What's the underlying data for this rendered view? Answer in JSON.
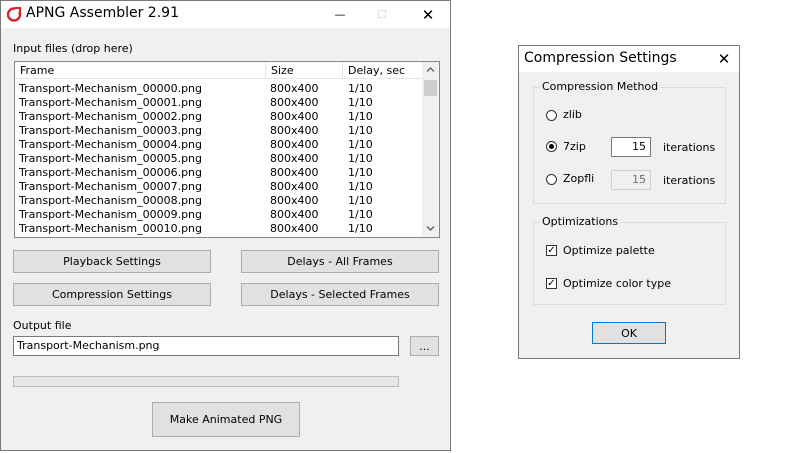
{
  "main_window": {
    "title": "APNG Assembler 2.91",
    "minimize_glyph": "—",
    "maximize_glyph": "☐",
    "close_glyph": "✕",
    "input_label": "Input files (drop here)",
    "columns": [
      "Frame",
      "Size",
      "Delay, sec"
    ],
    "rows": [
      {
        "frame": "Transport-Mechanism_00000.png",
        "size": "800x400",
        "delay": "1/10"
      },
      {
        "frame": "Transport-Mechanism_00001.png",
        "size": "800x400",
        "delay": "1/10"
      },
      {
        "frame": "Transport-Mechanism_00002.png",
        "size": "800x400",
        "delay": "1/10"
      },
      {
        "frame": "Transport-Mechanism_00003.png",
        "size": "800x400",
        "delay": "1/10"
      },
      {
        "frame": "Transport-Mechanism_00004.png",
        "size": "800x400",
        "delay": "1/10"
      },
      {
        "frame": "Transport-Mechanism_00005.png",
        "size": "800x400",
        "delay": "1/10"
      },
      {
        "frame": "Transport-Mechanism_00006.png",
        "size": "800x400",
        "delay": "1/10"
      },
      {
        "frame": "Transport-Mechanism_00007.png",
        "size": "800x400",
        "delay": "1/10"
      },
      {
        "frame": "Transport-Mechanism_00008.png",
        "size": "800x400",
        "delay": "1/10"
      },
      {
        "frame": "Transport-Mechanism_00009.png",
        "size": "800x400",
        "delay": "1/10"
      },
      {
        "frame": "Transport-Mechanism_00010.png",
        "size": "800x400",
        "delay": "1/10"
      }
    ],
    "buttons": {
      "playback": "Playback Settings",
      "delays_all": "Delays - All Frames",
      "compression": "Compression Settings",
      "delays_selected": "Delays - Selected Frames",
      "browse": "...",
      "make": "Make Animated PNG"
    },
    "output_label": "Output file",
    "output_value": "Transport-Mechanism.png",
    "progress": 0
  },
  "dialog": {
    "title": "Compression Settings",
    "close_glyph": "✕",
    "method_group": "Compression Method",
    "zlib": "zlib",
    "sevenzip": "7zip",
    "zopfli": "Zopfli",
    "sevenzip_iterations": "15",
    "zopfli_iterations": "15",
    "iterations_label": "iterations",
    "selected_method": "7zip",
    "opt_group": "Optimizations",
    "optimize_palette": "Optimize palette",
    "optimize_color_type": "Optimize color type",
    "check_glyph": "✓",
    "ok": "OK"
  },
  "icons": {
    "app": "apng-app-icon",
    "scroll_up": "chevron-up-icon",
    "scroll_down": "chevron-down-icon"
  }
}
